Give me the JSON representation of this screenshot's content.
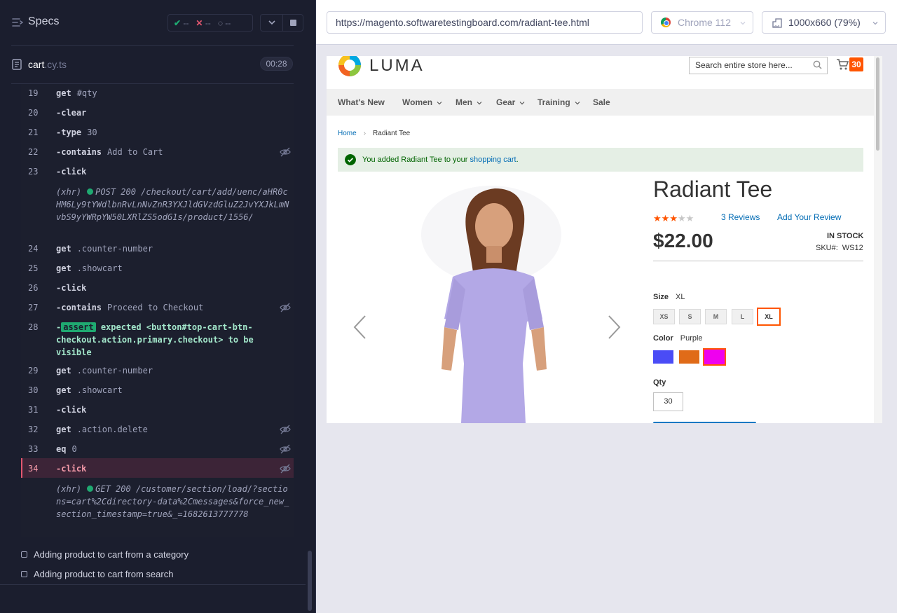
{
  "reporter": {
    "specs_title": "Specs",
    "stats": {
      "passed": "--",
      "failed": "--",
      "pending": "--"
    },
    "spec_file": {
      "name": "cart",
      "ext": ".cy.ts",
      "duration": "00:28"
    },
    "commands": [
      {
        "num": "19",
        "name": "get",
        "msg": "#qty"
      },
      {
        "num": "20",
        "name": "-clear",
        "msg": ""
      },
      {
        "num": "21",
        "name": "-type",
        "msg": "30"
      },
      {
        "num": "22",
        "name": "-contains",
        "msg": "Add to Cart"
      },
      {
        "num": "23",
        "name": "-click",
        "msg": ""
      },
      {
        "num": "24",
        "name": "get",
        "msg": ".counter-number"
      },
      {
        "num": "25",
        "name": "get",
        "msg": ".showcart"
      },
      {
        "num": "26",
        "name": "-click",
        "msg": ""
      },
      {
        "num": "27",
        "name": "-contains",
        "msg": "Proceed to Checkout"
      },
      {
        "num": "28",
        "name": "-",
        "msg": ""
      },
      {
        "num": "29",
        "name": "get",
        "msg": ".counter-number"
      },
      {
        "num": "30",
        "name": "get",
        "msg": ".showcart"
      },
      {
        "num": "31",
        "name": "-click",
        "msg": ""
      },
      {
        "num": "32",
        "name": "get",
        "msg": ".action.delete"
      },
      {
        "num": "33",
        "name": "eq",
        "msg": "0"
      },
      {
        "num": "34",
        "name": "-click",
        "msg": ""
      }
    ],
    "xhr_post": {
      "prefix": "(xhr)",
      "method": "POST 200",
      "url": "/checkout/cart/add/uenc/aHR0cHM6Ly9tYWdlbnRvLnNvZnR3YXJldGVzdGluZ2JvYXJkLmNvbS9yYWRpYW50LXRlZS5odG1s/product/1556/"
    },
    "assert": {
      "badge": "assert",
      "text": "expected <button#top-cart-btn-checkout.action.primary.checkout> to be visible"
    },
    "xhr_get": {
      "prefix": "(xhr)",
      "method": "GET 200",
      "url": "/customer/section/load/?sections=cart%2Cdirectory-data%2Cmessages&force_new_section_timestamp=true&_=1682613777778"
    },
    "tests": [
      "Adding product to cart from a category",
      "Adding product to cart from search"
    ]
  },
  "browser": {
    "url": "https://magento.softwaretestingboard.com/radiant-tee.html",
    "browser_name": "Chrome 112",
    "viewport": "1000x660 (79%)"
  },
  "aut": {
    "logo_text": "LUMA",
    "search_placeholder": "Search entire store here...",
    "cart_count": "30",
    "nav": [
      "What's New",
      "Women",
      "Men",
      "Gear",
      "Training",
      "Sale"
    ],
    "breadcrumb": {
      "home": "Home",
      "current": "Radiant Tee"
    },
    "success": {
      "before": "You added Radiant Tee to your ",
      "link": "shopping cart",
      "after": "."
    },
    "product": {
      "title": "Radiant Tee",
      "rating": 3,
      "rating_max": 5,
      "reviews": "3  Reviews",
      "add_review": "Add Your Review",
      "price": "$22.00",
      "stock": "IN STOCK",
      "sku_label": "SKU#:",
      "sku": "WS12",
      "size_label": "Size",
      "size_value": "XL",
      "sizes": [
        "XS",
        "S",
        "M",
        "L",
        "XL"
      ],
      "color_label": "Color",
      "color_value": "Purple",
      "swatch_colors": [
        "#4a4cf6",
        "#e06b18",
        "#ef00ef"
      ],
      "qty_label": "Qty",
      "qty": "30"
    }
  },
  "colors": {
    "accent": "#ff5501",
    "pass": "#1fa971",
    "fail": "#e45770",
    "link": "#006bb4"
  }
}
